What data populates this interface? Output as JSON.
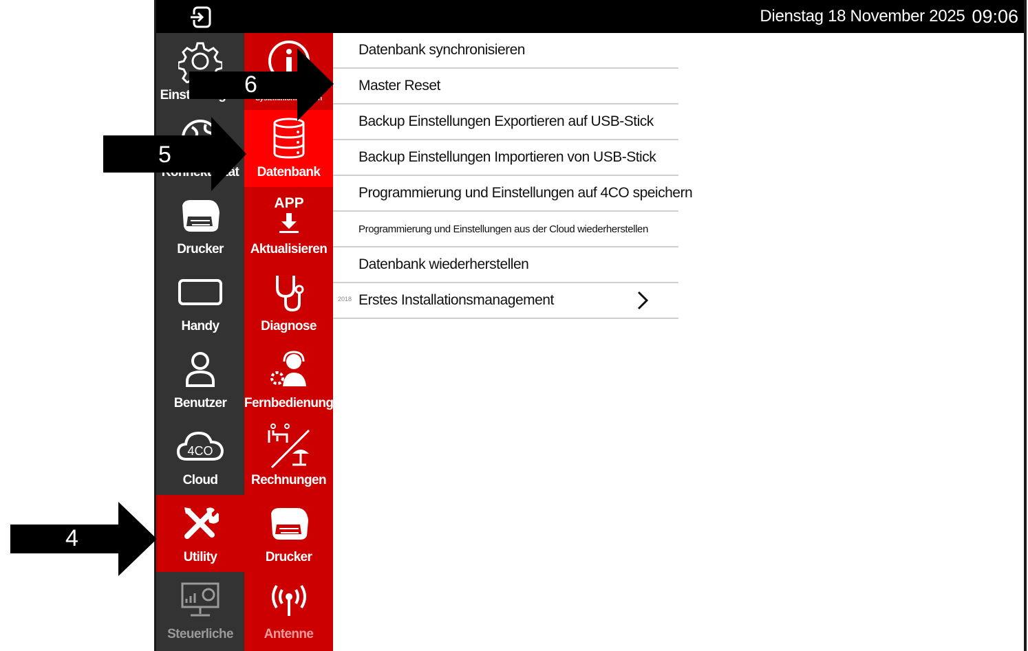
{
  "topbar": {
    "date": "Dienstag 18 November 2025",
    "time": "09:06",
    "exit_icon": "exit-icon"
  },
  "left_nav": [
    {
      "label": "Einstellungen",
      "icon": "gear-icon"
    },
    {
      "label": "Konnektivität",
      "icon": "globe-icon"
    },
    {
      "label": "Drucker",
      "icon": "printer-icon"
    },
    {
      "label": "Handy",
      "icon": "tablet-icon"
    },
    {
      "label": "Benutzer",
      "icon": "user-icon"
    },
    {
      "label": "Cloud",
      "icon": "cloud-icon",
      "icon_text": "4CO"
    },
    {
      "label": "Utility",
      "icon": "tools-icon"
    },
    {
      "label": "Steuerliche",
      "icon": "fiscal-monitor-icon"
    }
  ],
  "mid_nav": [
    {
      "label": "Systeminformationen",
      "icon": "info-icon"
    },
    {
      "label": "Datenbank",
      "icon": "database-icon"
    },
    {
      "label": "Aktualisieren",
      "icon": "app-download-icon",
      "icon_text": "APP"
    },
    {
      "label": "Diagnose",
      "icon": "stethoscope-icon"
    },
    {
      "label": "Fernbedienung",
      "icon": "remote-support-icon"
    },
    {
      "label": "Rechnungen",
      "icon": "restaurant-beach-icon"
    },
    {
      "label": "Drucker",
      "icon": "printer-icon"
    },
    {
      "label": "Antenne",
      "icon": "antenna-icon"
    }
  ],
  "menu": [
    {
      "label": "Datenbank synchronisieren"
    },
    {
      "label": "Master Reset"
    },
    {
      "label": "Backup Einstellungen Exportieren auf USB-Stick"
    },
    {
      "label": "Backup Einstellungen Importieren von USB-Stick"
    },
    {
      "label": "Programmierung und Einstellungen auf 4CO speichern"
    },
    {
      "label": "Programmierung und Einstellungen aus der Cloud wiederherstellen"
    },
    {
      "label": "Datenbank wiederherstellen"
    },
    {
      "label": "Erstes Installationsmanagement",
      "tag": "2018",
      "icon": "chevron-right-icon"
    }
  ],
  "annotations": [
    {
      "number": "4"
    },
    {
      "number": "5"
    },
    {
      "number": "6"
    }
  ],
  "colors": {
    "dark_column": "#333333",
    "red_column": "#cc0000",
    "active_bright": "#ff0000",
    "topbar": "#000000"
  }
}
